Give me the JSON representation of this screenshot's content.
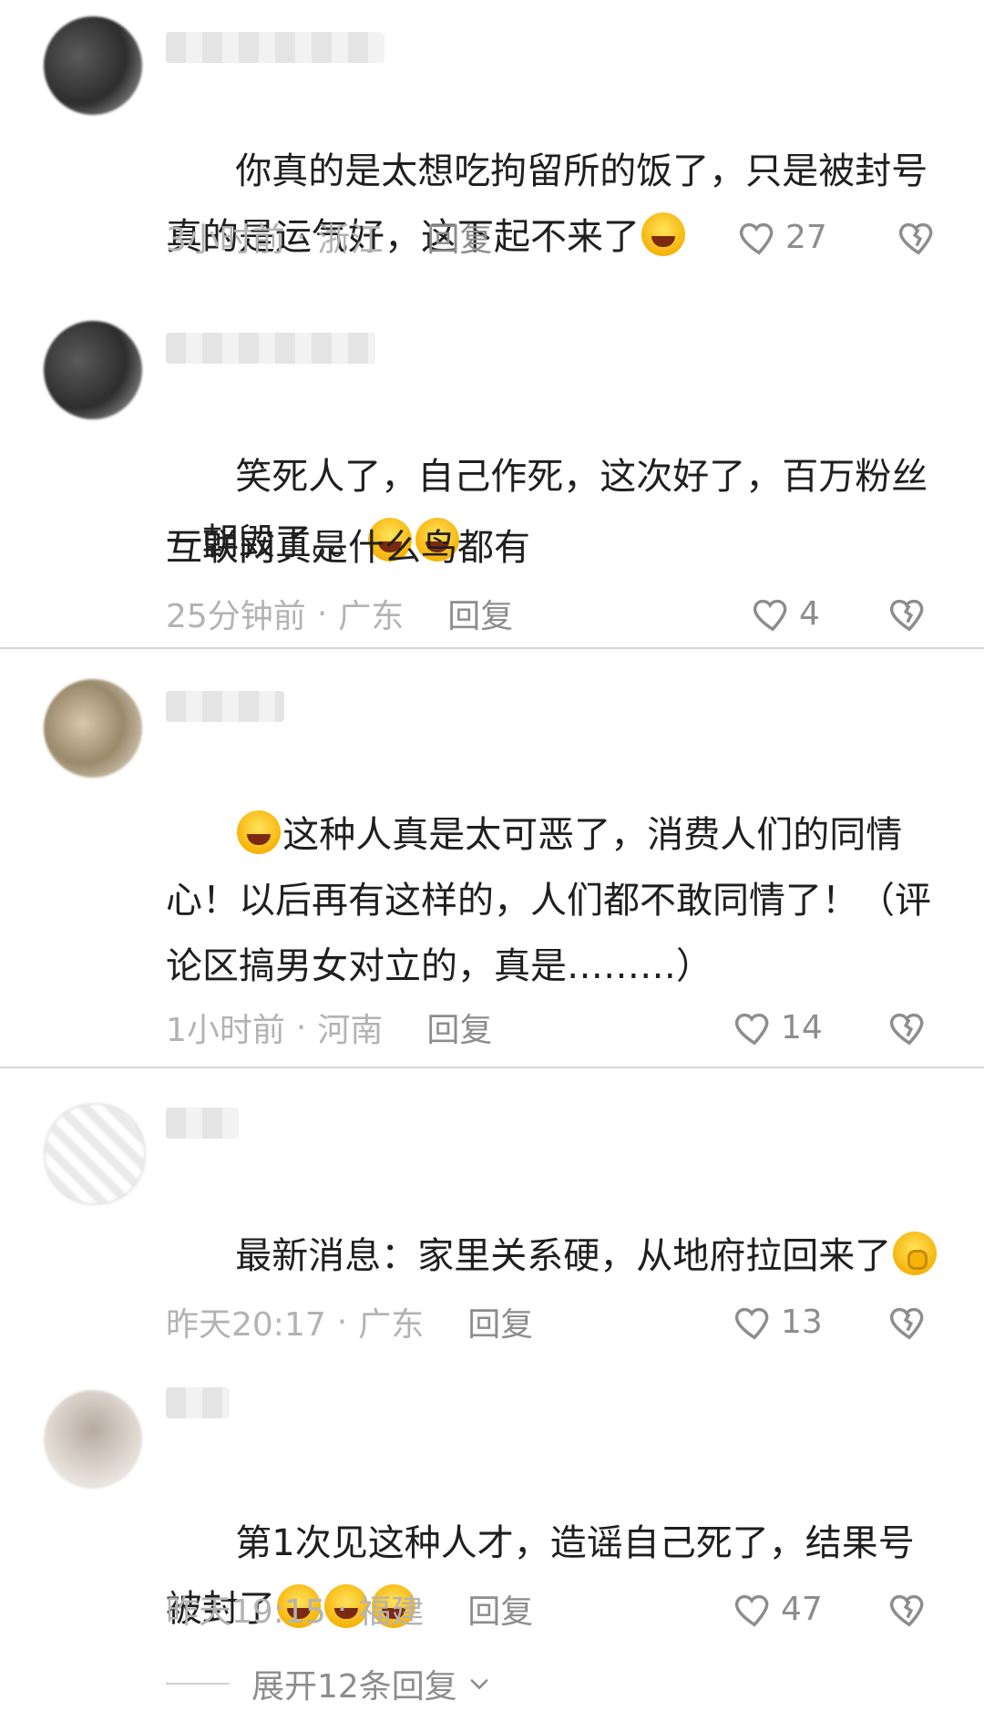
{
  "comments": [
    {
      "text": "你真的是太想吃拘留所的饭了，只是被封号真的是运气好，这下起不来了",
      "emoji_after": [
        "laugh-cry"
      ],
      "time": "3小时前",
      "location": "浙江",
      "reply": "回复",
      "likes": "27"
    },
    {
      "text": "笑死人了，自己作死，这次好了，百万粉丝一朝毁了。。",
      "emoji_after": [
        "grin-sweat",
        "grin-sweat"
      ],
      "text2": "互联网真是什么鸟都有",
      "time": "25分钟前",
      "location": "广东",
      "reply": "回复",
      "likes": "4"
    },
    {
      "text_pre_emoji": "grin-sweat",
      "text": "这种人真是太可恶了，消费人们的同情心！以后再有这样的，人们都不敢同情了！（评论区搞男女对立的，真是………）",
      "time": "1小时前",
      "location": "河南",
      "reply": "回复",
      "likes": "14"
    },
    {
      "text": "最新消息：家里关系硬，从地府拉回来了",
      "emoji_after": [
        "ok-hand"
      ],
      "time": "昨天20:17",
      "location": "广东",
      "reply": "回复",
      "likes": "13"
    },
    {
      "text": "第1次见这种人才，造谣自己死了，结果号被封了",
      "emoji_after": [
        "laugh-cry",
        "laugh-cry",
        "laugh-cry"
      ],
      "time": "昨天19:15",
      "location": "福建",
      "reply": "回复",
      "likes": "47"
    }
  ],
  "expand": {
    "label": "展开12条回复"
  },
  "colors": {
    "meta": "#b3b3b3",
    "reply": "#8d8d8d",
    "divider": "#d6d6d6",
    "emoji": "#f6b40b"
  },
  "icons": {
    "like": "heart-outline-icon",
    "dislike": "broken-heart-icon",
    "expand": "chevron-down-icon"
  }
}
